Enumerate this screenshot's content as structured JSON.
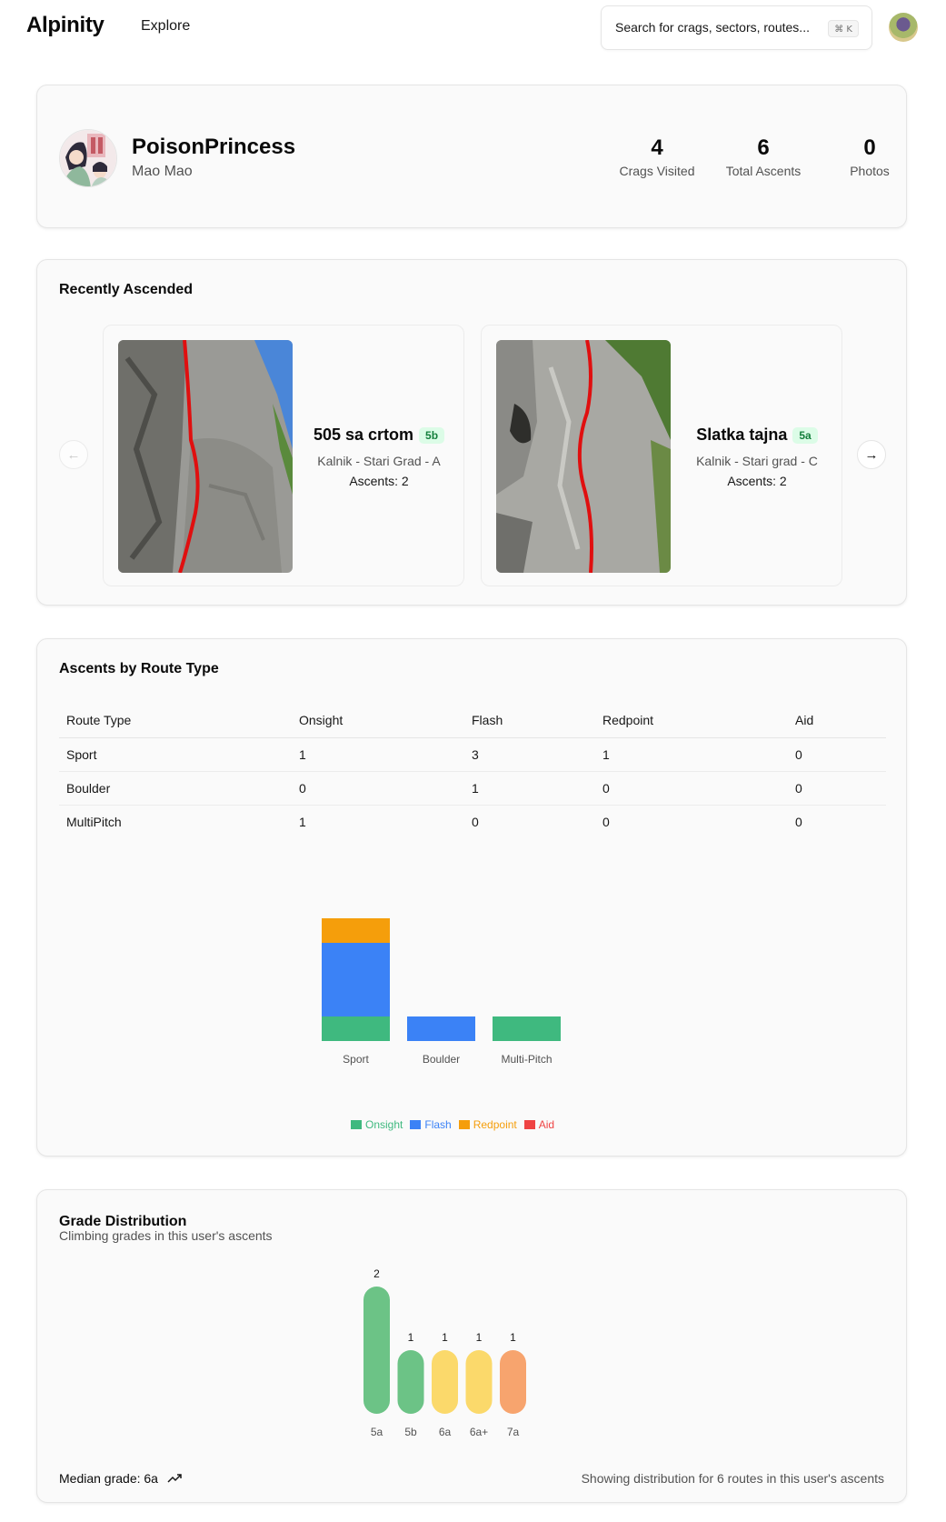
{
  "header": {
    "logo": "Alpinity",
    "nav_explore": "Explore",
    "search_placeholder": "Search for crags, sectors, routes...",
    "search_shortcut": "⌘ K"
  },
  "profile": {
    "username": "PoisonPrincess",
    "real_name": "Mao Mao",
    "stats": [
      {
        "value": "4",
        "label": "Crags Visited"
      },
      {
        "value": "6",
        "label": "Total Ascents"
      },
      {
        "value": "0",
        "label": "Photos"
      }
    ]
  },
  "recent": {
    "title": "Recently Ascended",
    "routes": [
      {
        "name": "505 sa crtom",
        "grade": "5b",
        "location": "Kalnik - Stari Grad - A",
        "ascents": "Ascents: 2"
      },
      {
        "name": "Slatka tajna",
        "grade": "5a",
        "location": "Kalnik - Stari grad - C",
        "ascents": "Ascents: 2"
      }
    ]
  },
  "by_type": {
    "title": "Ascents by Route Type",
    "columns": [
      "Route Type",
      "Onsight",
      "Flash",
      "Redpoint",
      "Aid"
    ],
    "rows": [
      [
        "Sport",
        "1",
        "3",
        "1",
        "0"
      ],
      [
        "Boulder",
        "0",
        "1",
        "0",
        "0"
      ],
      [
        "MultiPitch",
        "1",
        "0",
        "0",
        "0"
      ]
    ]
  },
  "grades": {
    "title": "Grade Distribution",
    "subtitle": "Climbing grades in this user's ascents",
    "median": "Median grade: 6a",
    "note": "Showing distribution for 6 routes in this user's ascents"
  },
  "colors": {
    "onsight": "#3fb97f",
    "flash": "#3b82f6",
    "redpoint": "#f59e0b",
    "aid": "#ef4444"
  },
  "chart_data": [
    {
      "type": "bar",
      "stacked": true,
      "categories": [
        "Sport",
        "Boulder",
        "Multi-Pitch"
      ],
      "series": [
        {
          "name": "Onsight",
          "values": [
            1,
            0,
            1
          ],
          "color": "#3fb97f"
        },
        {
          "name": "Flash",
          "values": [
            3,
            1,
            0
          ],
          "color": "#3b82f6"
        },
        {
          "name": "Redpoint",
          "values": [
            1,
            0,
            0
          ],
          "color": "#f59e0b"
        },
        {
          "name": "Aid",
          "values": [
            0,
            0,
            0
          ],
          "color": "#ef4444"
        }
      ],
      "legend": "bottom",
      "grid": false
    },
    {
      "type": "bar",
      "categories": [
        "5a",
        "5b",
        "6a",
        "6a+",
        "7a"
      ],
      "values": [
        2,
        1,
        1,
        1,
        1
      ],
      "colors": [
        "#6cc386",
        "#6cc386",
        "#fbd96b",
        "#fbd96b",
        "#f7a46e"
      ],
      "data_labels": true,
      "grid": false
    }
  ]
}
